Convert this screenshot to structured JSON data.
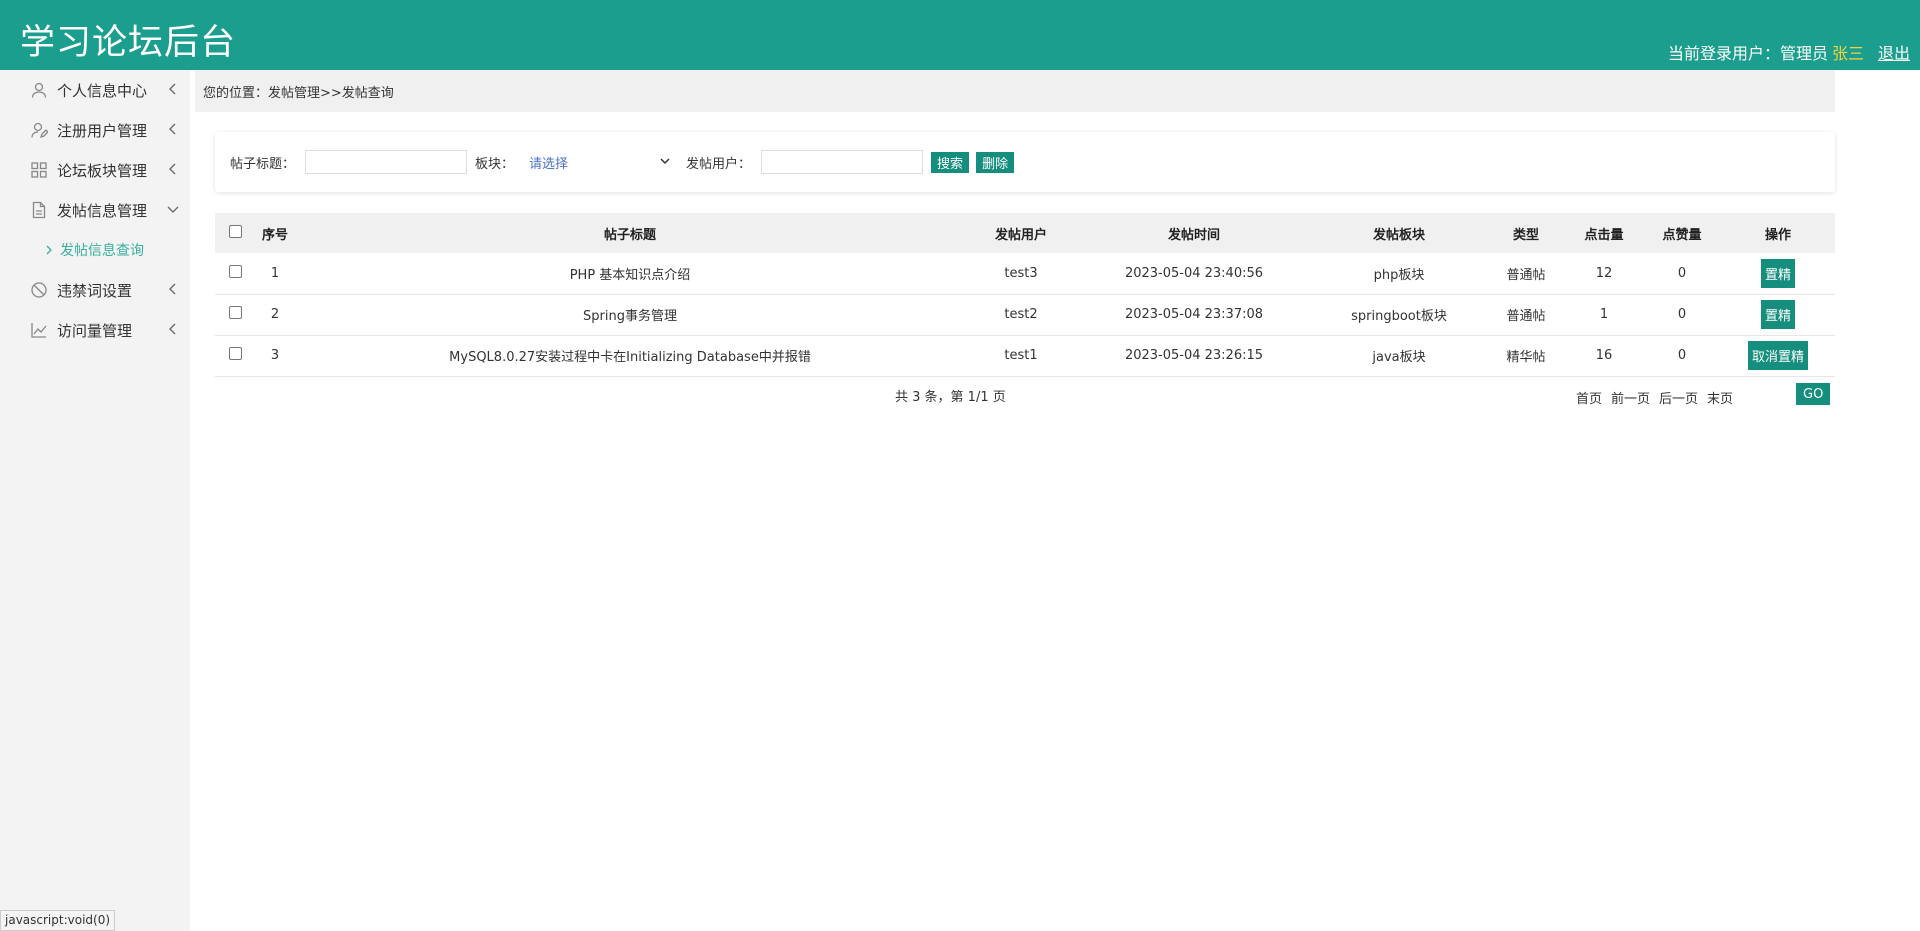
{
  "header": {
    "title": "学习论坛后台",
    "user_prefix": "当前登录用户：管理员",
    "user_name": "张三",
    "logout": "退出"
  },
  "sidebar": {
    "items": [
      {
        "label": "个人信息中心",
        "icon": "user-icon"
      },
      {
        "label": "注册用户管理",
        "icon": "user-edit-icon"
      },
      {
        "label": "论坛板块管理",
        "icon": "grid-icon"
      },
      {
        "label": "发帖信息管理",
        "icon": "document-icon"
      },
      {
        "label": "违禁词设置",
        "icon": "ban-icon"
      },
      {
        "label": "访问量管理",
        "icon": "line-chart-icon"
      }
    ],
    "sub_item": "发帖信息查询"
  },
  "breadcrumb": "您的位置：发帖管理>>发帖查询",
  "search": {
    "title_label": "帖子标题：",
    "title_value": "",
    "section_label": "板块：",
    "section_selected": "请选择",
    "user_label": "发帖用户：",
    "user_value": "",
    "search_button": "搜索",
    "delete_button": "删除"
  },
  "table": {
    "headers": [
      "序号",
      "帖子标题",
      "发帖用户",
      "发帖时间",
      "发帖板块",
      "类型",
      "点击量",
      "点赞量",
      "操作"
    ],
    "rows": [
      {
        "no": "1",
        "title": "PHP 基本知识点介绍",
        "user": "test3",
        "time": "2023-05-04 23:40:56",
        "section": "php板块",
        "type": "普通帖",
        "clicks": "12",
        "likes": "0",
        "action": "置精"
      },
      {
        "no": "2",
        "title": "Spring事务管理",
        "user": "test2",
        "time": "2023-05-04 23:37:08",
        "section": "springboot板块",
        "type": "普通帖",
        "clicks": "1",
        "likes": "0",
        "action": "置精"
      },
      {
        "no": "3",
        "title": "MySQL8.0.27安装过程中卡在Initializing Database中并报错",
        "user": "test1",
        "time": "2023-05-04 23:26:15",
        "section": "java板块",
        "type": "精华帖",
        "clicks": "16",
        "likes": "0",
        "action": "取消置精"
      }
    ]
  },
  "pager": {
    "summary": "共 3 条，第 1/1 页",
    "first": "首页",
    "prev": "前一页",
    "next": "后一页",
    "last": "末页",
    "page_value": "",
    "go": "GO"
  },
  "status_bar": "javascript:void(0)",
  "colors": {
    "header": "#1b9e8e",
    "accent": "#168e7e",
    "username": "#f5d142",
    "submenu": "#39b0a0"
  }
}
